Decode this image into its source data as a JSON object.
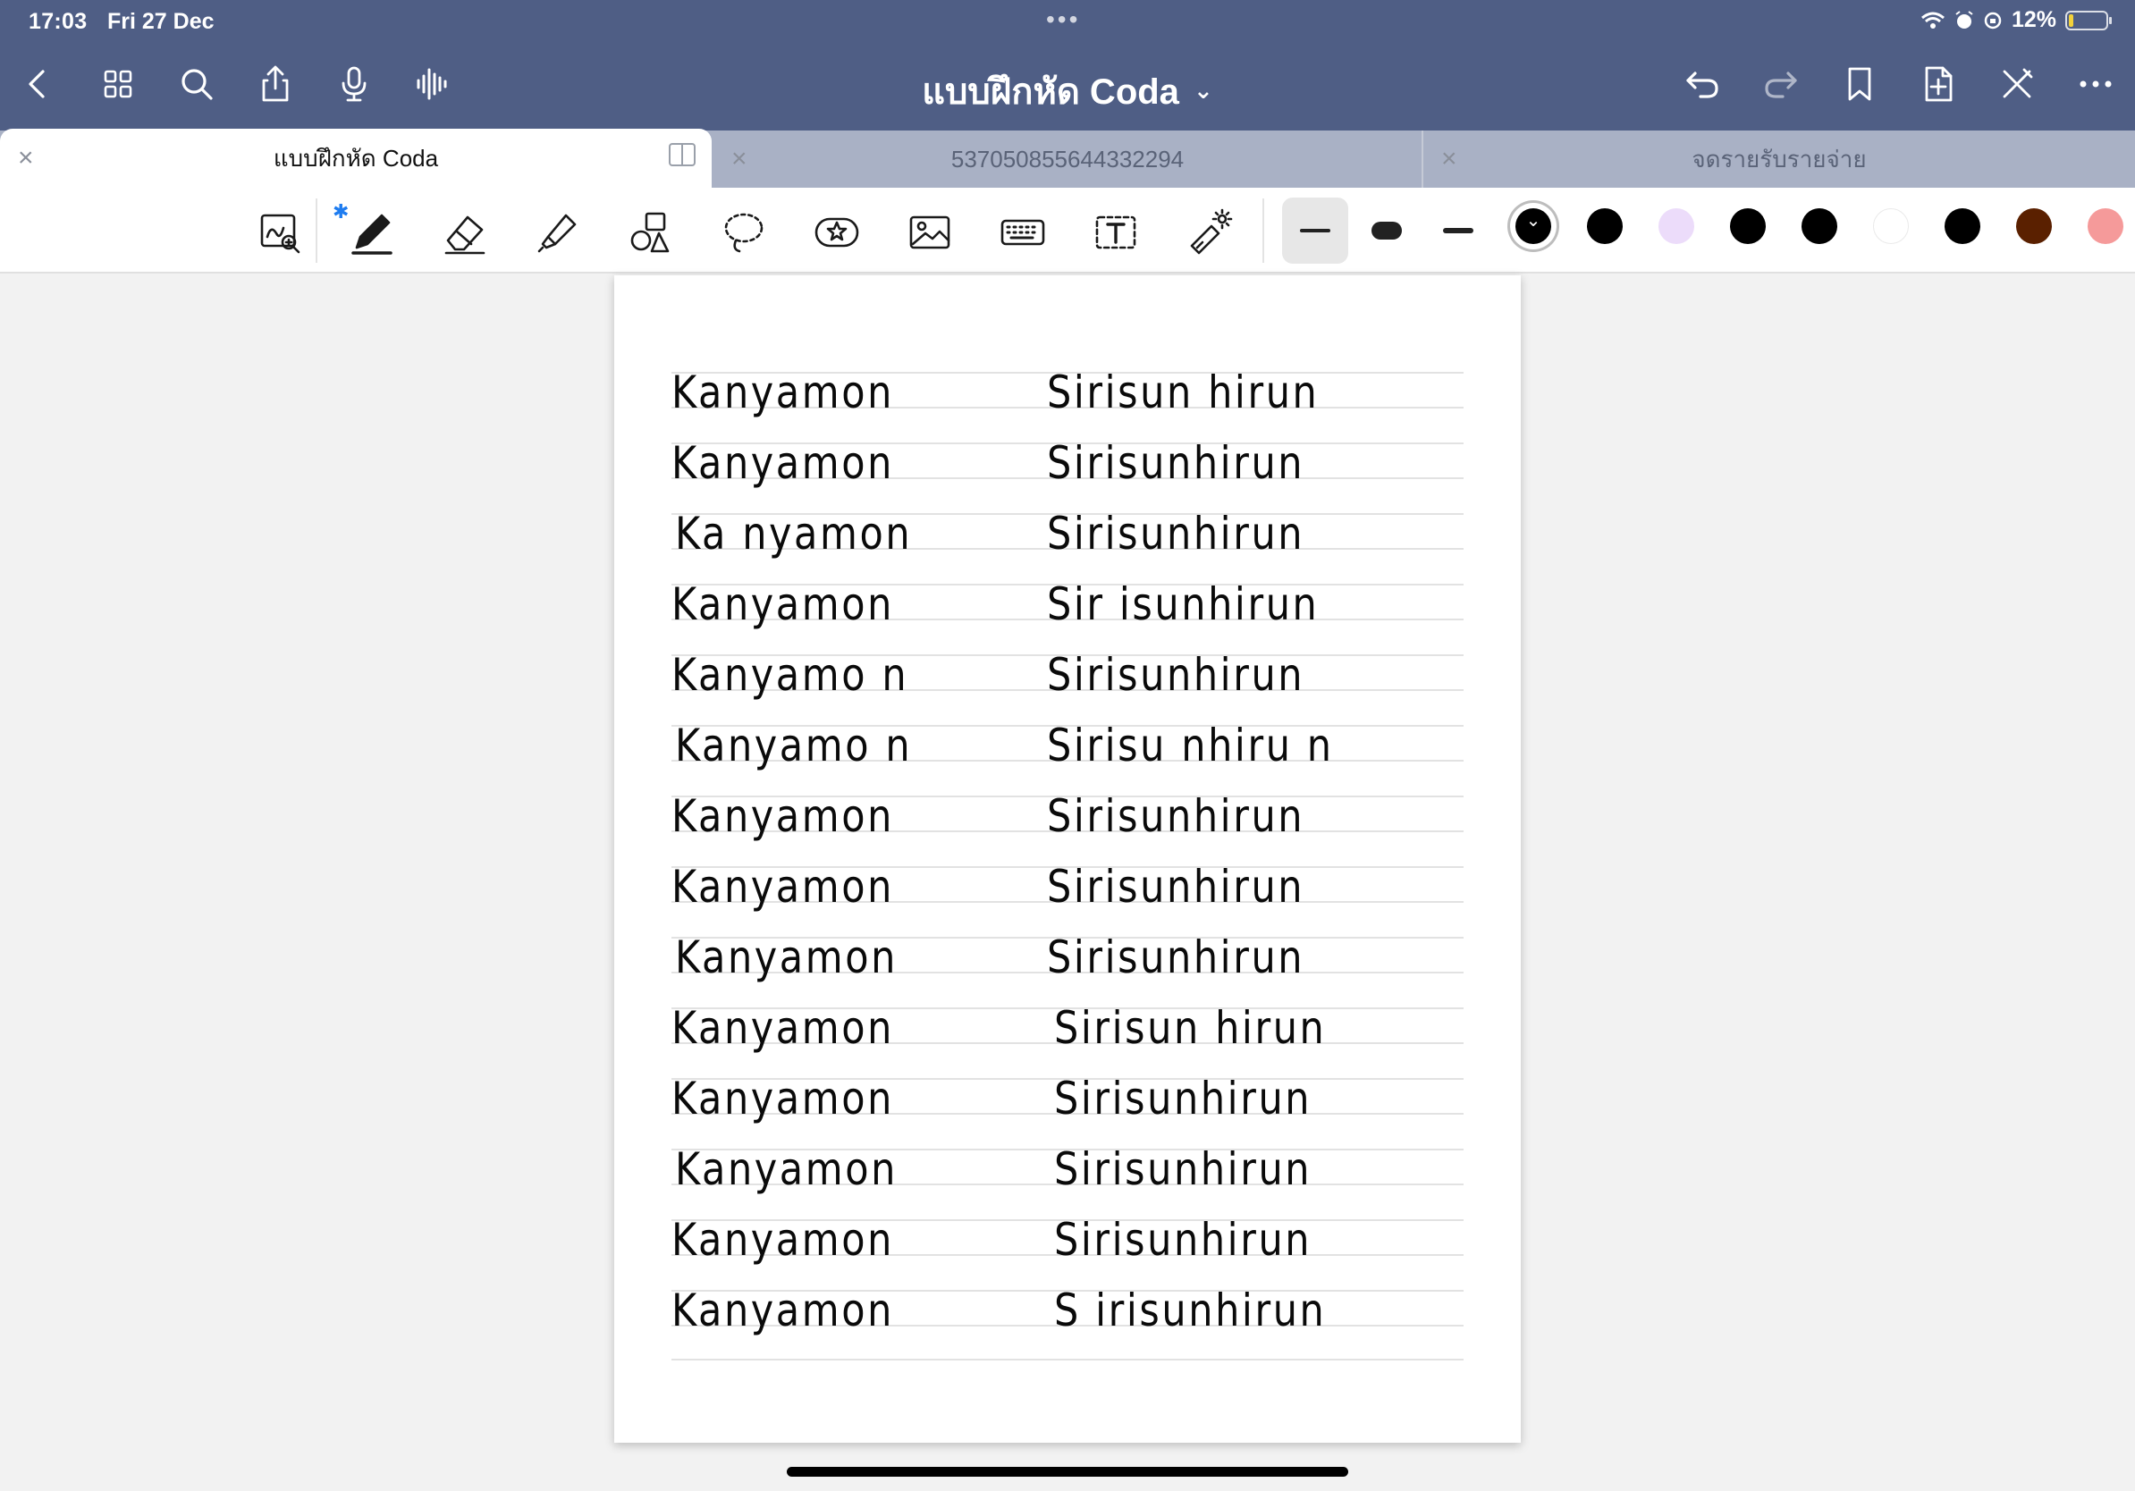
{
  "status": {
    "time": "17:03",
    "date": "Fri 27 Dec",
    "battery": "12%",
    "battery_level": 0.12
  },
  "nav": {
    "title": "แบบฝึกหัด Coda",
    "left_icons": [
      "back-icon",
      "grid-icon",
      "search-icon",
      "share-icon",
      "microphone-icon",
      "waveform-icon"
    ],
    "right_icons": [
      "undo-icon",
      "redo-icon",
      "bookmark-icon",
      "add-page-icon",
      "close-pen-icon",
      "more-icon"
    ]
  },
  "tabs": [
    {
      "label": "แบบฝึกหัด Coda",
      "active": true
    },
    {
      "label": "537050855644332294",
      "active": false
    },
    {
      "label": "จดรายรับรายจ่าย",
      "active": false
    }
  ],
  "toolbar": {
    "tools": [
      "zoom-window-icon",
      "pen-icon",
      "eraser-icon",
      "highlighter-icon",
      "shapes-icon",
      "lasso-icon",
      "sticker-icon",
      "image-icon",
      "keyboard-icon",
      "text-box-icon",
      "laser-pointer-icon"
    ],
    "bluetooth": "✱",
    "colors": [
      "#000000",
      "#000000",
      "#ecdcfa",
      "#000000",
      "#000000",
      "#ffffff",
      "#000000",
      "#5a2000",
      "#f59a9a"
    ]
  },
  "page": {
    "lines": [
      {
        "left": "Kanyamon",
        "right": "Sirisun hirun"
      },
      {
        "left": "Kanyamon",
        "right": "Sirisunhirun"
      },
      {
        "left": "Ka nyamon",
        "right": "Sirisunhirun"
      },
      {
        "left": "Kanyamon",
        "right": "Sir isunhirun"
      },
      {
        "left": "Kanyamo n",
        "right": "Sirisunhirun"
      },
      {
        "left": "Kanyamo n",
        "right": "Sirisu nhiru n"
      },
      {
        "left": "Kanyamon",
        "right": "Sirisunhirun"
      },
      {
        "left": "Kanyamon",
        "right": "Sirisunhirun"
      },
      {
        "left": "Kanyamon",
        "right": "Sirisunhirun"
      },
      {
        "left": "Kanyamon",
        "right": "Sirisun hirun"
      },
      {
        "left": "Kanyamon",
        "right": "Sirisunhirun"
      },
      {
        "left": "Kanyamon",
        "right": "Sirisunhirun"
      },
      {
        "left": "Kanyamon",
        "right": "Sirisunhirun"
      },
      {
        "left": "Kanyamon",
        "right": "S irisunhirun"
      }
    ]
  }
}
